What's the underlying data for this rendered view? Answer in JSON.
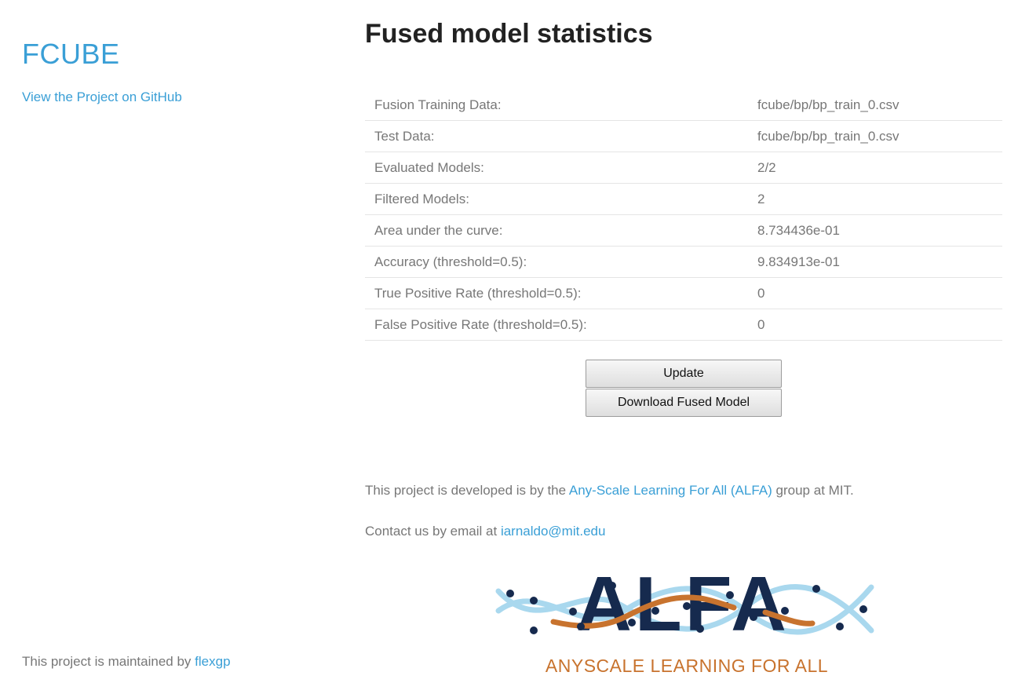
{
  "sidebar": {
    "title": "FCUBE",
    "github_link": "View the Project on GitHub",
    "maintained_prefix": "This project is maintained by",
    "maintainer": "flexgp"
  },
  "main": {
    "title": "Fused model statistics",
    "stats": [
      {
        "label": "Fusion Training Data:",
        "value": "fcube/bp/bp_train_0.csv"
      },
      {
        "label": "Test Data:",
        "value": "fcube/bp/bp_train_0.csv"
      },
      {
        "label": "Evaluated Models:",
        "value": "2/2"
      },
      {
        "label": "Filtered Models:",
        "value": "2"
      },
      {
        "label": "Area under the curve:",
        "value": "8.734436e-01"
      },
      {
        "label": "Accuracy (threshold=0.5):",
        "value": "9.834913e-01"
      },
      {
        "label": "True Positive Rate (threshold=0.5):",
        "value": "0"
      },
      {
        "label": "False Positive Rate (threshold=0.5):",
        "value": "0"
      }
    ],
    "buttons": {
      "update": "Update",
      "download": "Download Fused Model"
    },
    "credit_prefix": "This project is developed is by the",
    "credit_link": "Any-Scale Learning For All (ALFA)",
    "credit_suffix": "group at MIT.",
    "contact_prefix": "Contact us by email at",
    "contact_email": "iarnaldo@mit.edu",
    "logo": {
      "word": "ALFA",
      "tagline": "ANYSCALE LEARNING FOR ALL",
      "colors": {
        "navy": "#162a4e",
        "orange": "#c8732e",
        "lightblue": "#a9d8ee"
      }
    }
  },
  "colors": {
    "link": "#3a9fd6",
    "text": "#777777",
    "heading": "#222222"
  }
}
